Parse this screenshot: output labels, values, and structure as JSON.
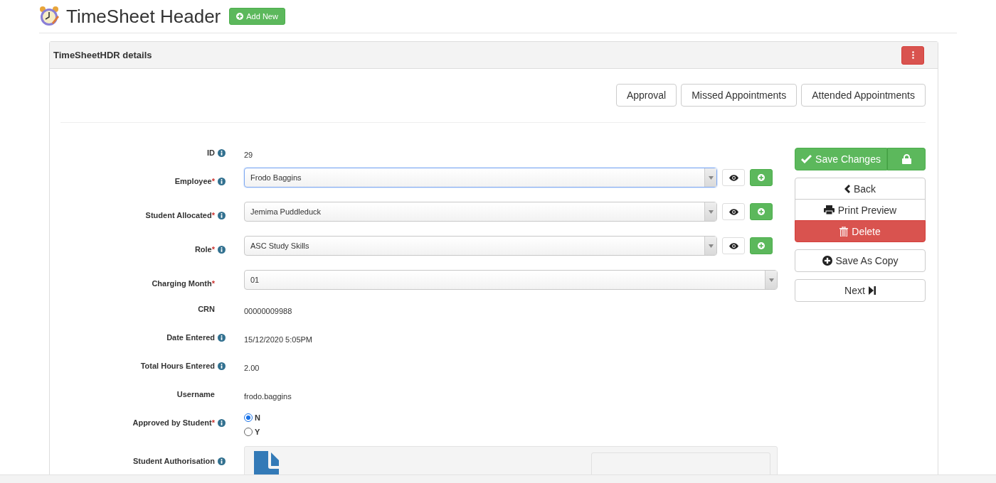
{
  "page": {
    "title": "TimeSheet Header",
    "add_button": "Add New"
  },
  "panel": {
    "title": "TimeSheetHDR details",
    "tabs": [
      "Approval",
      "Missed Appointments",
      "Attended Appointments"
    ],
    "fields": [
      {
        "kind": "text",
        "label": "ID",
        "info": true,
        "value": "29"
      },
      {
        "kind": "select",
        "label": "Employee",
        "required_mark": "*",
        "info": true,
        "value": "Frodo Baggins",
        "focused": true,
        "extra_buttons": true
      },
      {
        "kind": "select",
        "label": "Student Allocated",
        "required_mark": "*",
        "info": true,
        "value": "Jemima Puddleduck",
        "focused": false,
        "extra_buttons": true
      },
      {
        "kind": "select",
        "label": "Role",
        "required_mark": "*",
        "info": true,
        "value": "ASC Study Skills",
        "focused": false,
        "extra_buttons": true
      },
      {
        "kind": "select",
        "label": "Charging Month",
        "required_mark": "*",
        "info": false,
        "value": "01",
        "focused": false,
        "extra_buttons": false
      },
      {
        "kind": "text",
        "label": "CRN",
        "info": false,
        "value": "00000009988"
      },
      {
        "kind": "text",
        "label": "Date Entered",
        "info": true,
        "value": "15/12/2020 5:05PM"
      },
      {
        "kind": "text",
        "label": "Total Hours Entered",
        "info": true,
        "value": "2.00"
      },
      {
        "kind": "text",
        "label": "Username",
        "info": false,
        "value": "frodo.baggins"
      },
      {
        "kind": "radio",
        "label": "Approved by Student",
        "required_mark": "*",
        "info": true,
        "options": [
          {
            "label": "N",
            "selected": true
          },
          {
            "label": "Y",
            "selected": false
          }
        ]
      },
      {
        "kind": "upload",
        "label": "Student Authorisation",
        "info": true
      }
    ],
    "actions": [
      {
        "kind": "save",
        "label": "Save Changes"
      },
      {
        "kind": "back",
        "label": "Back"
      },
      {
        "kind": "print",
        "label": "Print Preview"
      },
      {
        "kind": "delete",
        "label": "Delete"
      },
      {
        "kind": "copy",
        "label": "Save As Copy"
      },
      {
        "kind": "next",
        "label": "Next"
      }
    ]
  }
}
